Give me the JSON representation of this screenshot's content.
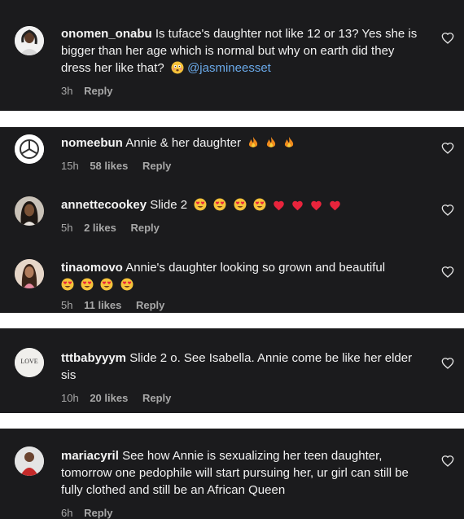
{
  "comments": [
    {
      "username": "onomen_onabu",
      "text": "Is tuface's daughter not like 12 or 13? Yes she is bigger than her age which is normal but why on earth did they dress her like that?",
      "mention": "@jasmineesset",
      "time": "3h",
      "likes": "",
      "reply": "Reply"
    },
    {
      "username": "nomeebun",
      "text": "Annie & her daughter",
      "time": "15h",
      "likes": "58 likes",
      "reply": "Reply"
    },
    {
      "username": "annettecookey",
      "text": "Slide 2",
      "time": "5h",
      "likes": "2 likes",
      "reply": "Reply"
    },
    {
      "username": "tinaomovo",
      "text": "Annie's daughter looking so grown and beautiful",
      "time": "5h",
      "likes": "11 likes",
      "reply": "Reply"
    },
    {
      "username": "tttbabyyym",
      "text": "Slide 2 o. See Isabella. Annie come be like her elder sis",
      "time": "10h",
      "likes": "20 likes",
      "reply": "Reply"
    },
    {
      "username": "mariacyril",
      "text": "See how Annie is sexualizing her teen daughter, tomorrow one pedophile will start pursuing her, ur girl can still be fully clothed and still be an African Queen",
      "time": "6h",
      "likes": "",
      "reply": "Reply"
    }
  ],
  "avatar_texts": {
    "tttbabyyym": "LOVE"
  },
  "colors": {
    "background": "#1b1b1d",
    "text": "#f2f2f2",
    "meta": "#a8a8a8",
    "mention": "#6aa9e9",
    "separator": "#ffffff"
  }
}
